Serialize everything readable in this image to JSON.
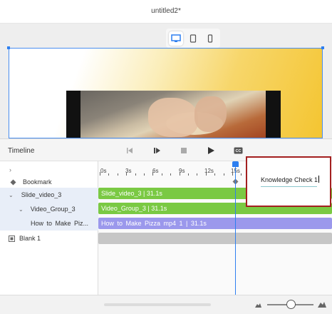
{
  "window": {
    "title": "untitled2*"
  },
  "device_preview": {
    "selected": "desktop",
    "options": [
      "desktop-icon",
      "tablet-icon",
      "phone-icon"
    ]
  },
  "timeline": {
    "label": "Timeline",
    "ruler_ticks": [
      "0s",
      "3s",
      "6s",
      "9s",
      "12s",
      "15s"
    ],
    "playhead_label": "15s",
    "rows": {
      "bookmark": "Bookmark",
      "slide": "Slide_video_3",
      "group": "Video_Group_3",
      "video": "How to Make Piz...",
      "blank": "Blank 1"
    },
    "bars": {
      "slide": "Slide_video_3 | 31.1s",
      "group": "Video_Group_3 | 31.1s",
      "video": "How to Make Pizza mp4 1 | 31.1s"
    }
  },
  "popup": {
    "value": "Knowledge Check 1"
  },
  "colors": {
    "accent": "#2d7ff0",
    "bar_green": "#7ac943",
    "bar_purple": "#9b98ec",
    "popup_border": "#a31f1f"
  }
}
